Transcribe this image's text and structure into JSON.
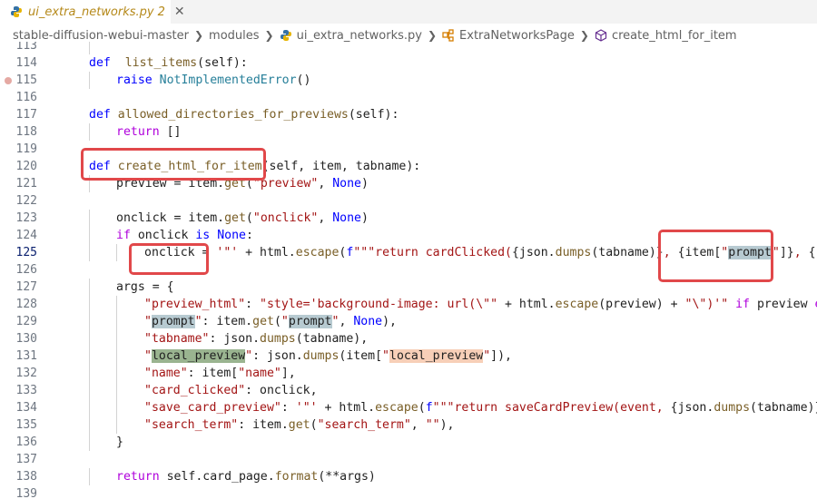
{
  "tab": {
    "title": "ui_extra_networks.py",
    "badge": "2",
    "close_glyph": "✕"
  },
  "breadcrumb": [
    {
      "label": "stable-diffusion-webui-master",
      "icon": ""
    },
    {
      "label": "modules",
      "icon": ""
    },
    {
      "label": "ui_extra_networks.py",
      "icon": "python-icon"
    },
    {
      "label": "ExtraNetworksPage",
      "icon": "class-icon"
    },
    {
      "label": "create_html_for_item",
      "icon": "method-icon"
    }
  ],
  "lines": [
    {
      "n": "113",
      "tokens": []
    },
    {
      "n": "114",
      "tokens": [
        [
          "k",
          "def"
        ],
        [
          "",
          "  "
        ],
        [
          "f",
          "list_items"
        ],
        [
          "",
          "(self):"
        ]
      ]
    },
    {
      "n": "115",
      "tokens": [
        [
          "k",
          "raise"
        ],
        [
          "",
          " "
        ],
        [
          "c",
          "NotImplementedError"
        ],
        [
          "",
          "()"
        ]
      ]
    },
    {
      "n": "116",
      "tokens": []
    },
    {
      "n": "117",
      "tokens": [
        [
          "k",
          "def"
        ],
        [
          "",
          " "
        ],
        [
          "f",
          "allowed_directories_for_previews"
        ],
        [
          "",
          "(self):"
        ]
      ]
    },
    {
      "n": "118",
      "tokens": [
        [
          "kc",
          "return"
        ],
        [
          "",
          " []"
        ]
      ]
    },
    {
      "n": "119",
      "tokens": []
    },
    {
      "n": "120",
      "tokens": [
        [
          "k",
          "def"
        ],
        [
          "",
          " "
        ],
        [
          "f",
          "create_html_for_item"
        ],
        [
          "",
          "(self, item, tabname):"
        ]
      ]
    },
    {
      "n": "121",
      "tokens": [
        [
          "",
          "preview = item."
        ],
        [
          "f",
          "get"
        ],
        [
          "",
          "("
        ],
        [
          "s",
          "\"preview\""
        ],
        [
          "",
          ", "
        ],
        [
          "k",
          "None"
        ],
        [
          "",
          ")"
        ]
      ]
    },
    {
      "n": "122",
      "tokens": []
    },
    {
      "n": "123",
      "tokens": [
        [
          "",
          "onclick = item."
        ],
        [
          "f",
          "get"
        ],
        [
          "",
          "("
        ],
        [
          "s",
          "\"onclick\""
        ],
        [
          "",
          ", "
        ],
        [
          "k",
          "None"
        ],
        [
          "",
          ")"
        ]
      ]
    },
    {
      "n": "124",
      "tokens": [
        [
          "kc",
          "if"
        ],
        [
          "",
          " onclick "
        ],
        [
          "k",
          "is"
        ],
        [
          "",
          " "
        ],
        [
          "k",
          "None"
        ],
        [
          "",
          ":"
        ]
      ]
    },
    {
      "n": "125",
      "tokens": [
        [
          "",
          "onclick = "
        ],
        [
          "s",
          "'\"'"
        ],
        [
          "",
          " + html."
        ],
        [
          "f",
          "escape"
        ],
        [
          "",
          "("
        ],
        [
          "k",
          "f"
        ],
        [
          "s",
          "\"\"\"return cardClicked("
        ],
        [
          "",
          "{json."
        ],
        [
          "f",
          "dumps"
        ],
        [
          "",
          "(tabname)}"
        ],
        [
          "s",
          ", "
        ],
        [
          "",
          "{item["
        ],
        [
          "s",
          "\""
        ],
        [
          "hl1",
          "prompt"
        ],
        [
          "caret",
          ""
        ],
        [
          "s",
          "\""
        ],
        [
          "",
          "]}"
        ],
        [
          "s",
          ", "
        ],
        [
          "",
          "{\"tru"
        ]
      ]
    },
    {
      "n": "126",
      "tokens": []
    },
    {
      "n": "127",
      "tokens": [
        [
          "",
          "args = {"
        ]
      ]
    },
    {
      "n": "128",
      "tokens": [
        [
          "s",
          "\"preview_html\""
        ],
        [
          "",
          ": "
        ],
        [
          "s",
          "\"style='background-image: url(\\\"\""
        ],
        [
          "",
          " + html."
        ],
        [
          "f",
          "escape"
        ],
        [
          "",
          "(preview) + "
        ],
        [
          "s",
          "\"\\\")'\""
        ],
        [
          "",
          " "
        ],
        [
          "kc",
          "if"
        ],
        [
          "",
          " preview "
        ],
        [
          "kc",
          "else"
        ]
      ]
    },
    {
      "n": "129",
      "tokens": [
        [
          "s",
          "\""
        ],
        [
          "hl1",
          "prompt"
        ],
        [
          "s",
          "\""
        ],
        [
          "",
          ": item."
        ],
        [
          "f",
          "get"
        ],
        [
          "",
          "("
        ],
        [
          "s",
          "\""
        ],
        [
          "hl1",
          "prompt"
        ],
        [
          "s",
          "\""
        ],
        [
          "",
          ", "
        ],
        [
          "k",
          "None"
        ],
        [
          "",
          "),"
        ]
      ]
    },
    {
      "n": "130",
      "tokens": [
        [
          "s",
          "\"tabname\""
        ],
        [
          "",
          ": json."
        ],
        [
          "f",
          "dumps"
        ],
        [
          "",
          "(tabname),"
        ]
      ]
    },
    {
      "n": "131",
      "tokens": [
        [
          "s",
          "\""
        ],
        [
          "hl2",
          "local_preview"
        ],
        [
          "s",
          "\""
        ],
        [
          "",
          ": json."
        ],
        [
          "f",
          "dumps"
        ],
        [
          "",
          "(item["
        ],
        [
          "s",
          "\""
        ],
        [
          "hl3",
          "local_preview"
        ],
        [
          "s",
          "\""
        ],
        [
          "",
          "]),"
        ]
      ]
    },
    {
      "n": "132",
      "tokens": [
        [
          "s",
          "\"name\""
        ],
        [
          "",
          ": item["
        ],
        [
          "s",
          "\"name\""
        ],
        [
          "",
          "],"
        ]
      ]
    },
    {
      "n": "133",
      "tokens": [
        [
          "s",
          "\"card_clicked\""
        ],
        [
          "",
          ": onclick,"
        ]
      ]
    },
    {
      "n": "134",
      "tokens": [
        [
          "s",
          "\"save_card_preview\""
        ],
        [
          "",
          ": "
        ],
        [
          "s",
          "'\"'"
        ],
        [
          "",
          " + html."
        ],
        [
          "f",
          "escape"
        ],
        [
          "",
          "("
        ],
        [
          "k",
          "f"
        ],
        [
          "s",
          "\"\"\"return saveCardPreview(event, "
        ],
        [
          "",
          "{json."
        ],
        [
          "f",
          "dumps"
        ],
        [
          "",
          "(tabname)}"
        ],
        [
          "s",
          ", {"
        ]
      ]
    },
    {
      "n": "135",
      "tokens": [
        [
          "s",
          "\"search_term\""
        ],
        [
          "",
          ": item."
        ],
        [
          "f",
          "get"
        ],
        [
          "",
          "("
        ],
        [
          "s",
          "\"search_term\""
        ],
        [
          "",
          ", "
        ],
        [
          "s",
          "\"\""
        ],
        [
          "",
          "),"
        ]
      ]
    },
    {
      "n": "136",
      "tokens": [
        [
          "",
          "}"
        ]
      ]
    },
    {
      "n": "137",
      "tokens": []
    },
    {
      "n": "138",
      "tokens": [
        [
          "kc",
          "return"
        ],
        [
          "",
          " self.card_page."
        ],
        [
          "f",
          "format"
        ],
        [
          "",
          "(**args)"
        ]
      ]
    },
    {
      "n": "139",
      "tokens": []
    }
  ]
}
